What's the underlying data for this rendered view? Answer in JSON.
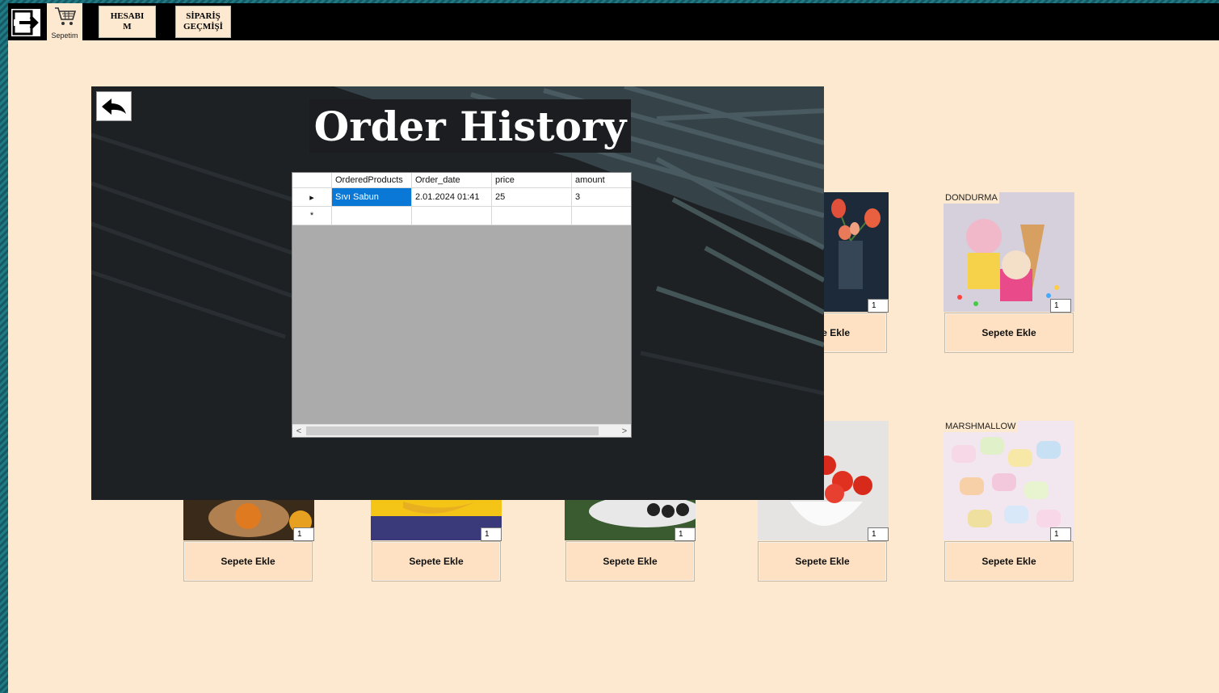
{
  "toolbar": {
    "cart_label": "Sepetim",
    "hesabim_label": "HESABI\nM",
    "siparis_label": "SİPARİŞ\nGEÇMİŞİ"
  },
  "order_history": {
    "title": "Order History",
    "columns": [
      "OrderedProducts",
      "Order_date",
      "price",
      "amount"
    ],
    "rows": [
      {
        "indicator": "▸",
        "product": "Sıvı Sabun",
        "date": "2.01.2024 01:41",
        "price": "25",
        "amount": "3"
      },
      {
        "indicator": "*",
        "product": "",
        "date": "",
        "price": "",
        "amount": ""
      }
    ]
  },
  "products": [
    {
      "name": "",
      "icon": "flowers-image",
      "qty": "1",
      "button": "Sepete Ekle",
      "partial_label": "e Ekle"
    },
    {
      "name": "DONDURMA",
      "icon": "ice-cream-image",
      "qty": "1",
      "button": "Sepete Ekle"
    },
    {
      "name": "",
      "icon": "tea-image",
      "qty": "1",
      "button": "Sepete Ekle"
    },
    {
      "name": "",
      "icon": "banana-image",
      "qty": "1",
      "button": "Sepete Ekle"
    },
    {
      "name": "",
      "icon": "olives-image",
      "qty": "1",
      "button": "Sepete Ekle"
    },
    {
      "name": "",
      "icon": "tomatoes-image",
      "qty": "1",
      "button": "Sepete Ekle"
    },
    {
      "name": "MARSHMALLOW",
      "icon": "marshmallow-image",
      "qty": "1",
      "button": "Sepete Ekle"
    }
  ],
  "colors": {
    "background": "#fde9cf",
    "toolbar": "#000000",
    "panel": "#1e2124",
    "selection": "#0a78d7"
  }
}
